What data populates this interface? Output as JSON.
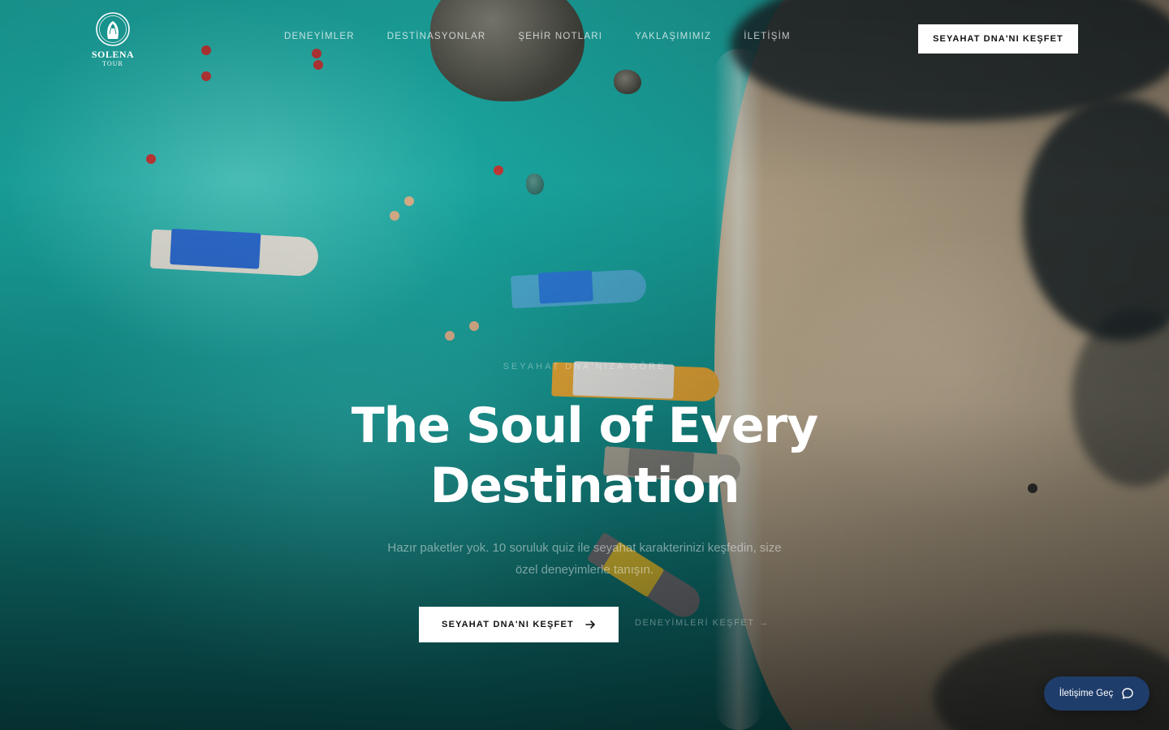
{
  "brand": {
    "name": "SOLENA",
    "sub": "TOUR"
  },
  "nav": {
    "items": [
      {
        "label": "DENEYİMLER"
      },
      {
        "label": "DESTİNASYONLAR"
      },
      {
        "label": "ŞEHİR NOTLARI"
      },
      {
        "label": "YAKLAŞIMIMIZ"
      },
      {
        "label": "İLETİŞİM"
      }
    ],
    "cta_label": "SEYAHAT DNA'NI KEŞFET"
  },
  "hero": {
    "eyebrow": "SEYAHAT DNA'NIZA GÖRE",
    "title_line1": "The Soul of Every",
    "title_line2": "Destination",
    "subtitle": "Hazır paketler yok. 10 soruluk quiz ile seyahat karakterinizi keşfedin, size özel deneyimlerle tanışın.",
    "primary_label": "SEYAHAT DNA'NI KEŞFET",
    "secondary_label": "DENEYİMLERİ KEŞFET",
    "secondary_arrow": "→"
  },
  "contact": {
    "label": "İletişime Geç",
    "icon": "chat-bubble-icon"
  },
  "colors": {
    "pill": "#1f3d6b",
    "water": "#19a8a2",
    "sand": "#d8c5a6"
  }
}
